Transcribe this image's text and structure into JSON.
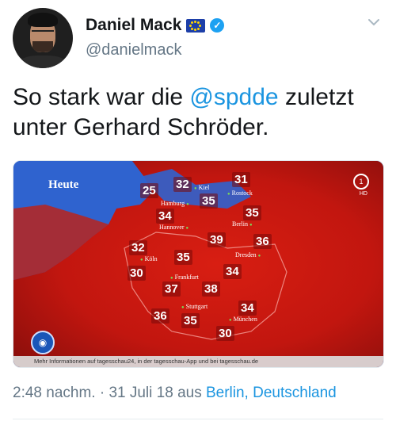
{
  "author": {
    "display_name": "Daniel Mack",
    "handle": "@danielmack",
    "verified_icon": "verified-badge-icon",
    "flag_icon": "eu-flag-icon"
  },
  "tweet": {
    "text_before": "So stark war die ",
    "mention": "@spdde",
    "text_after": " zuletzt unter Gerhard Schröder."
  },
  "media": {
    "title": "Heute",
    "caption": "Mehr Informationen auf tagesschau24, in der tagesschau-App und bei tagesschau.de",
    "ard_label": "1",
    "hd_label": "HD",
    "temps": [
      "25",
      "32",
      "31",
      "35",
      "34",
      "35",
      "39",
      "36",
      "32",
      "35",
      "30",
      "34",
      "37",
      "38",
      "34",
      "36",
      "35",
      "30"
    ],
    "cities": [
      "Kiel",
      "Rostock",
      "Hamburg",
      "Hannover",
      "Berlin",
      "Köln",
      "Dresden",
      "Frankfurt",
      "Stuttgart",
      "München"
    ]
  },
  "meta": {
    "time_date": "2:48 nachm. · 31 Juli 18 aus ",
    "location": "Berlin, Deutschland"
  },
  "colors": {
    "accent": "#1b95e0",
    "map_hot": "#c8140f",
    "sea": "#2f63cf"
  }
}
